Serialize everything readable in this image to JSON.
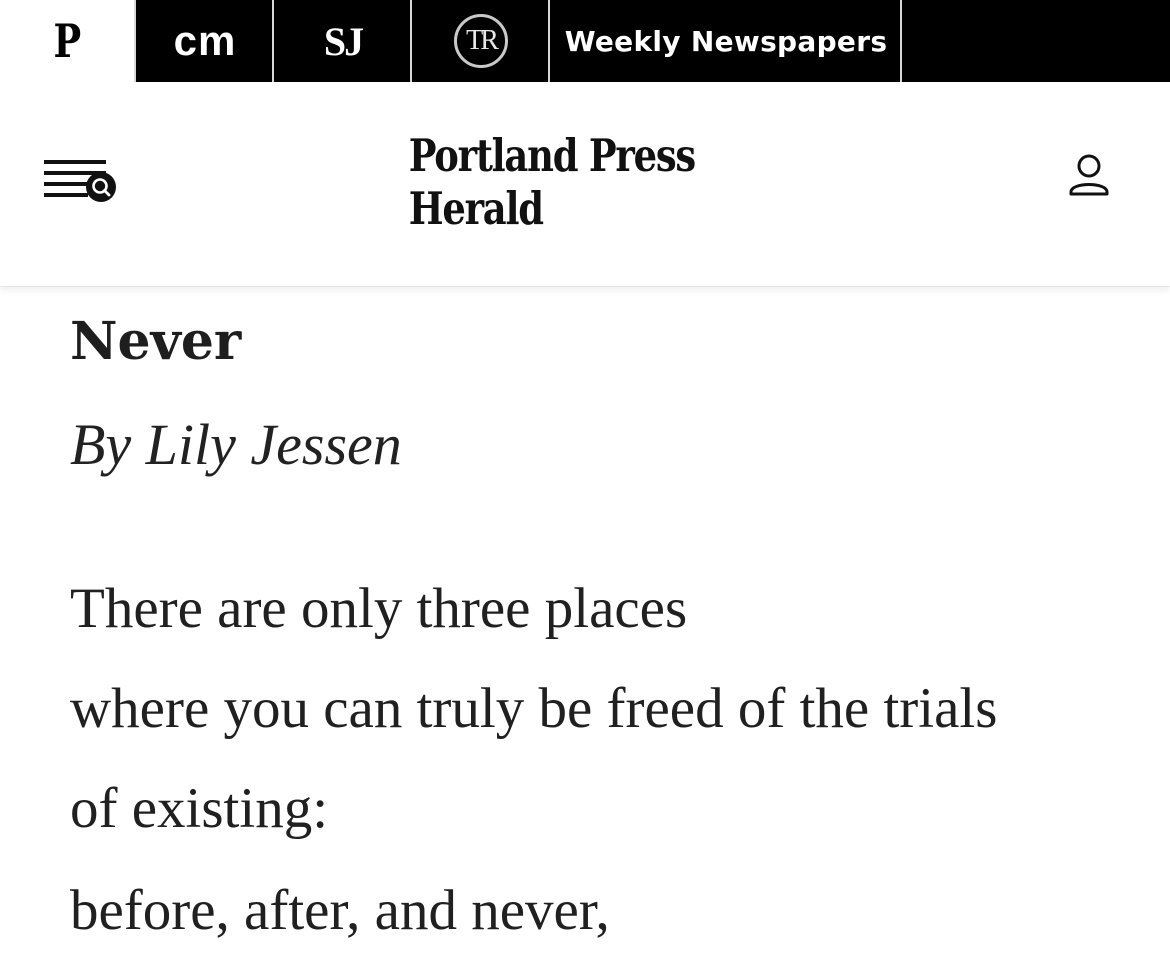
{
  "network_bar": {
    "tabs": [
      {
        "label": "P",
        "icon": "portland-press-herald-p-logo"
      },
      {
        "label": "cm",
        "icon": "centralmaine-logo"
      },
      {
        "label": "SJ",
        "icon": "sun-journal-logo"
      },
      {
        "label": "TR",
        "icon": "times-record-logo"
      },
      {
        "label": "Weekly Newspapers"
      }
    ]
  },
  "header": {
    "logo_text": "Portland Press Herald",
    "menu_icon": "menu-search-icon",
    "account_icon": "user-account-icon"
  },
  "article": {
    "title": "Never",
    "byline": "By Lily Jessen",
    "lines": [
      "There are only three places",
      "where you can truly be freed of the trials",
      "of existing:",
      "before, after, and never,"
    ]
  },
  "colors": {
    "topbar_bg": "#000000",
    "text": "#1f1f1f",
    "background": "#ffffff"
  }
}
